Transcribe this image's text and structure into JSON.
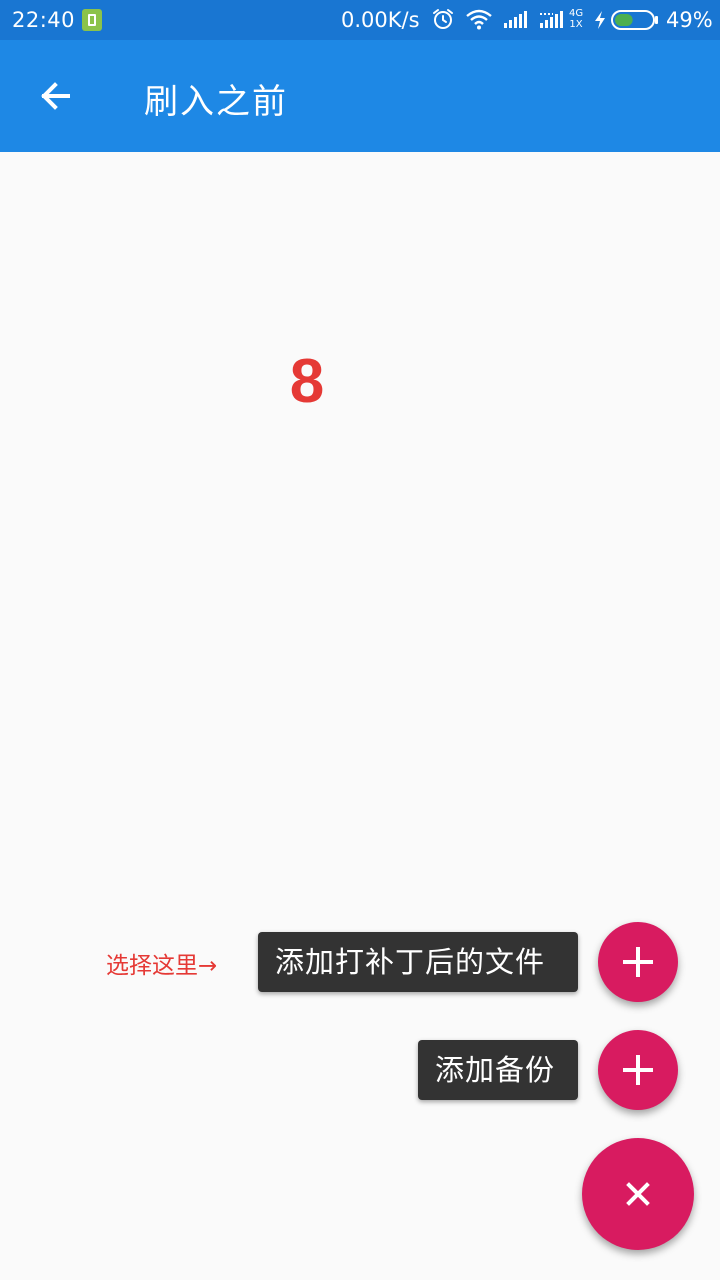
{
  "status_bar": {
    "time": "22:40",
    "net_speed": "0.00K/s",
    "network_type_top": "4G",
    "network_type_bottom": "1X",
    "battery_percent": "49%",
    "battery_level": 0.49,
    "icons": [
      "sim-icon",
      "alarm-icon",
      "wifi-icon",
      "signal-icon",
      "signal-icon",
      "charge-icon",
      "battery-icon"
    ],
    "colors": {
      "background": "#1976d2",
      "battery_fill": "#4caf50",
      "sim_icon": "#8bc34a"
    }
  },
  "app_bar": {
    "back_icon": "back-arrow-icon",
    "title": "刷入之前",
    "background": "#1e88e5"
  },
  "main": {
    "counter": "8",
    "counter_color": "#e53935",
    "hint": "选择这里→"
  },
  "fab_menu": {
    "accent": "#d81b60",
    "items": [
      {
        "label": "添加打补丁后的文件",
        "icon": "plus-icon"
      },
      {
        "label": "添加备份",
        "icon": "plus-icon"
      }
    ],
    "main_icon": "close-icon"
  }
}
